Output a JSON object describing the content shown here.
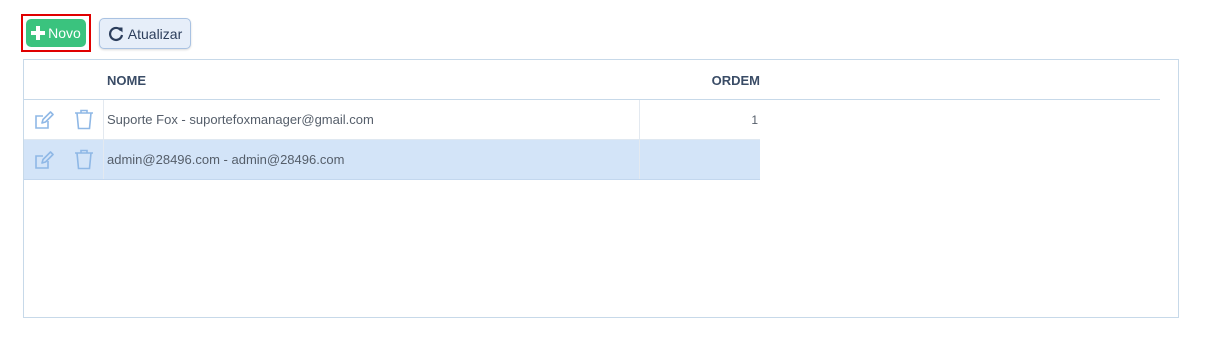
{
  "toolbar": {
    "new_label": "Novo",
    "refresh_label": "Atualizar"
  },
  "table": {
    "columns": {
      "nome": "NOME",
      "ordem": "ORDEM"
    },
    "rows": [
      {
        "nome": "Suporte Fox - suportefoxmanager@gmail.com",
        "ordem": "1",
        "selected": false
      },
      {
        "nome": "admin@28496.com - admin@28496.com",
        "ordem": "",
        "selected": true
      }
    ]
  },
  "icons": {
    "new": "plus-icon",
    "refresh": "reload-icon",
    "edit": "edit-icon",
    "delete": "trash-icon"
  },
  "colors": {
    "new_button": "#3ac37e",
    "highlight_frame": "#e00000",
    "selected_row": "#d3e4f8",
    "icon_blue": "#8fb8e6"
  }
}
